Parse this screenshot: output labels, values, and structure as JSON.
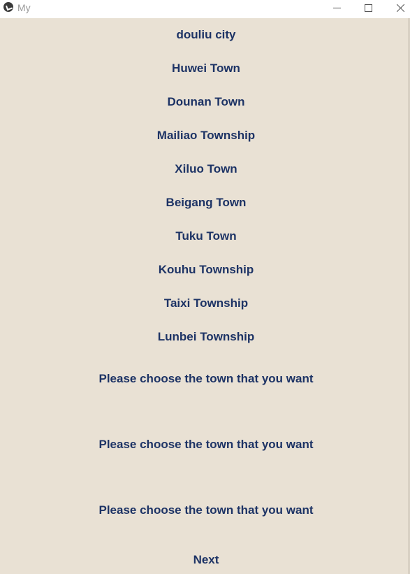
{
  "window": {
    "title": "My"
  },
  "towns": [
    "douliu city",
    "Huwei Town",
    "Dounan Town",
    "Mailiao Township",
    "Xiluo Town",
    "Beigang Town",
    "Tuku Town",
    "Kouhu Township",
    "Taixi Township",
    "Lunbei Township"
  ],
  "prompts": [
    "Please choose the town that you want",
    "Please choose the town that you want",
    "Please choose the town that you want"
  ],
  "next_label": "Next",
  "colors": {
    "background": "#e9e1d4",
    "text": "#1d3365"
  }
}
